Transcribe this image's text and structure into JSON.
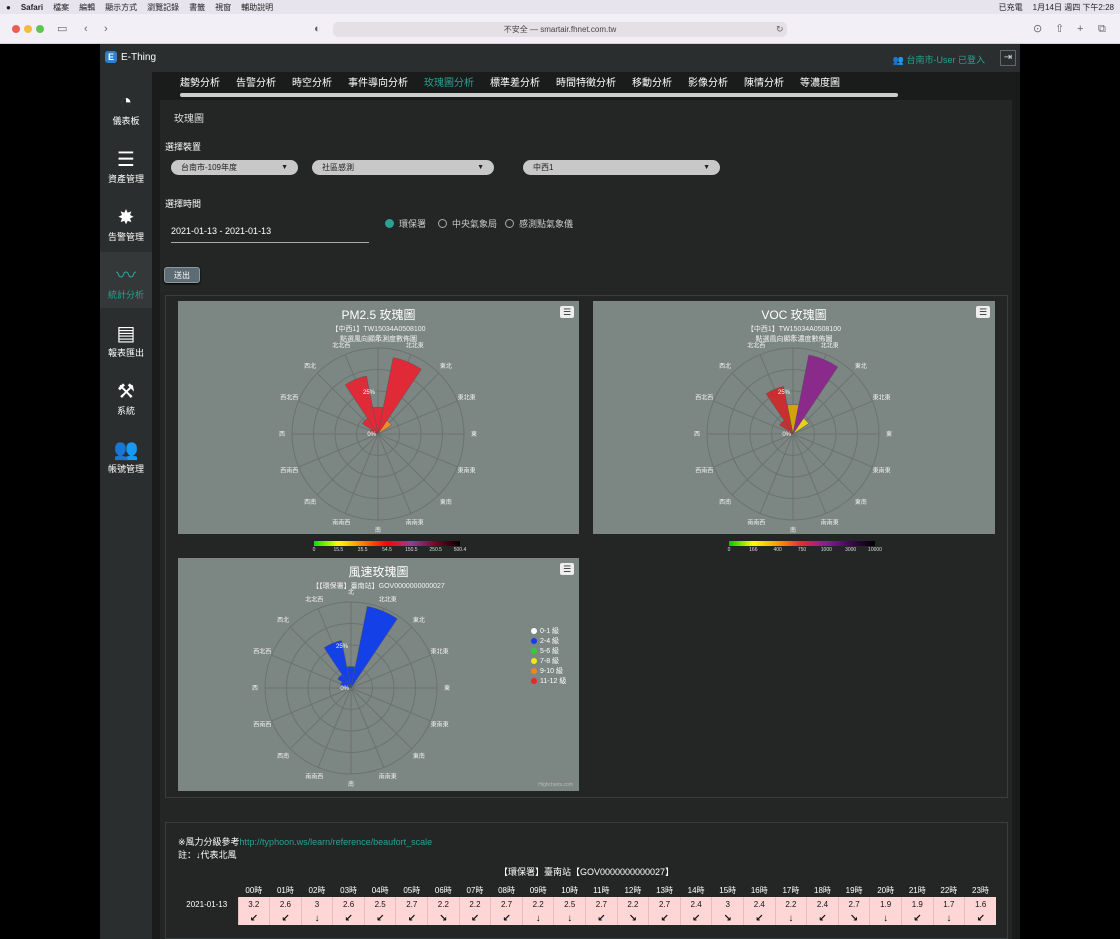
{
  "mac": {
    "left": [
      "Safari",
      "檔案",
      "編輯",
      "顯示方式",
      "瀏覽記錄",
      "書籤",
      "視窗",
      "輔助說明"
    ],
    "battery": "已充電",
    "datetime": "1月14日 週四 下午2:28"
  },
  "browser": {
    "url": "不安全 — smartair.fhnet.com.tw"
  },
  "app": {
    "logo_letter": "E",
    "name": "E-Thing",
    "user": "台南市-User 已登入"
  },
  "sidebar": [
    {
      "label": "儀表板",
      "icon": "gauge-icon",
      "glyph": "◔"
    },
    {
      "label": "資產管理",
      "icon": "server-icon",
      "glyph": "☰"
    },
    {
      "label": "告警管理",
      "icon": "alert-icon",
      "glyph": "✸"
    },
    {
      "label": "統計分析",
      "icon": "chart-line-icon",
      "glyph": "〰"
    },
    {
      "label": "報表匯出",
      "icon": "report-icon",
      "glyph": "▤"
    },
    {
      "label": "系統",
      "icon": "tools-icon",
      "glyph": "⚒"
    },
    {
      "label": "帳號管理",
      "icon": "users-icon",
      "glyph": "👥"
    }
  ],
  "tabs": [
    "趨勢分析",
    "告警分析",
    "時空分析",
    "事件導向分析",
    "玫瑰圖分析",
    "標準差分析",
    "時間特徵分析",
    "移動分析",
    "影像分析",
    "陳情分析",
    "等濃度圖"
  ],
  "panel": {
    "title": "玫瑰圖",
    "device_label": "選擇裝置",
    "selects": [
      "台南市-109年度",
      "社區感測",
      "中西1"
    ],
    "time_label": "選擇時間",
    "date_range": "2021-01-13 - 2021-01-13",
    "radios": [
      {
        "label": "環保署",
        "checked": true
      },
      {
        "label": "中央氣象局",
        "checked": false
      },
      {
        "label": "感測點氣象儀",
        "checked": false
      }
    ],
    "submit": "送出"
  },
  "charts": {
    "directions": [
      "北",
      "北北東",
      "東北",
      "東北東",
      "東",
      "東南東",
      "東南",
      "南南東",
      "南",
      "南南西",
      "西南",
      "西南西",
      "西",
      "西北西",
      "西北",
      "北北西"
    ],
    "pm25": {
      "title": "PM2.5 玫瑰圖",
      "subtitle1": "【中西1】TW15034A0508100",
      "subtitle2": "點選風向顯示測度數佈圖",
      "ring_labels": [
        "25%",
        "0%"
      ],
      "colorbar_ticks": [
        "0",
        "15.5",
        "35.5",
        "54.5",
        "150.5",
        "250.5",
        "500.4"
      ],
      "colorbar_colors": [
        "#00e400",
        "#ffff00",
        "#ff7e00",
        "#ff0000",
        "#8f3f97",
        "#7e0023",
        "#000000"
      ],
      "petals": [
        {
          "dir": "北",
          "value": 10,
          "color": "#e02a38"
        },
        {
          "dir": "北北東",
          "value": 29,
          "color": "#e02a38"
        },
        {
          "dir": "北北西",
          "value": 22,
          "color": "#e02a38"
        },
        {
          "dir": "東北",
          "value": 6,
          "color": "#f28a2c"
        },
        {
          "dir": "西北",
          "value": 7,
          "color": "#e02a38"
        },
        {
          "dir": "西北西",
          "value": 3,
          "color": "#e02a38"
        }
      ]
    },
    "voc": {
      "title": "VOC 玫瑰圖",
      "subtitle1": "【中西1】TW15034A0508100",
      "subtitle2": "點選風向顯示濃度數佈圖",
      "ring_labels": [
        "25%",
        "0%"
      ],
      "colorbar_ticks": [
        "0",
        "166",
        "400",
        "750",
        "1000",
        "3000",
        "10000"
      ],
      "colorbar_colors": [
        "#00c800",
        "#ffff00",
        "#ff9900",
        "#e02a38",
        "#8a1a9a",
        "#3a0a4a",
        "#000000"
      ],
      "petals": [
        {
          "dir": "北",
          "value": 11,
          "color": "#d4a20a"
        },
        {
          "dir": "北北東",
          "value": 30,
          "color": "#8a2a8a"
        },
        {
          "dir": "北北西",
          "value": 18,
          "color": "#c83030"
        },
        {
          "dir": "東北",
          "value": 7,
          "color": "#e8d020"
        },
        {
          "dir": "西北",
          "value": 6,
          "color": "#c83030"
        },
        {
          "dir": "西北西",
          "value": 2,
          "color": "#c83030"
        }
      ]
    },
    "wind": {
      "title": "風速玫瑰圖",
      "subtitle1": "【【環保署】臺南站】GOV0000000000027",
      "ring_labels": [
        "25%",
        "0%"
      ],
      "credits": "Highcharts.com",
      "legend": [
        {
          "label": "0-1 級",
          "color": "#ffffff"
        },
        {
          "label": "2-4 級",
          "color": "#1440e8"
        },
        {
          "label": "5-6 級",
          "color": "#2ed12e"
        },
        {
          "label": "7-8 級",
          "color": "#f5e614"
        },
        {
          "label": "9-10 級",
          "color": "#f5821e"
        },
        {
          "label": "11-12 級",
          "color": "#e62828"
        }
      ],
      "petals": [
        {
          "dir": "北",
          "value": 8,
          "color": "#1440e8"
        },
        {
          "dir": "北北東",
          "value": 31,
          "color": "#1440e8"
        },
        {
          "dir": "北北西",
          "value": 18,
          "color": "#1440e8"
        },
        {
          "dir": "西北",
          "value": 6,
          "color": "#1440e8"
        },
        {
          "dir": "西北西",
          "value": 4,
          "color": "#1440e8"
        }
      ]
    }
  },
  "windtable": {
    "note_prefix": "※風力分級參考",
    "link": "http://typhoon.ws/learn/reference/beaufort_scale",
    "note2": "註：↓代表北風",
    "title": "【環保署】臺南站【GOV0000000000027】",
    "date": "2021-01-13",
    "hours": [
      "00時",
      "01時",
      "02時",
      "03時",
      "04時",
      "05時",
      "06時",
      "07時",
      "08時",
      "09時",
      "10時",
      "11時",
      "12時",
      "13時",
      "14時",
      "15時",
      "16時",
      "17時",
      "18時",
      "19時",
      "20時",
      "21時",
      "22時",
      "23時"
    ],
    "speeds": [
      "3.2",
      "2.6",
      "3",
      "2.6",
      "2.5",
      "2.7",
      "2.2",
      "2.2",
      "2.7",
      "2.2",
      "2.5",
      "2.7",
      "2.2",
      "2.7",
      "2.4",
      "3",
      "2.4",
      "2.2",
      "2.4",
      "2.7",
      "1.9",
      "1.9",
      "1.7",
      "1.6"
    ],
    "arrows": [
      "↙",
      "↙",
      "↓",
      "↙",
      "↙",
      "↙",
      "↘",
      "↙",
      "↙",
      "↓",
      "↓",
      "↙",
      "↘",
      "↙",
      "↙",
      "↘",
      "↙",
      "↓",
      "↙",
      "↘",
      "↓",
      "↙",
      "↓",
      "↙"
    ]
  }
}
